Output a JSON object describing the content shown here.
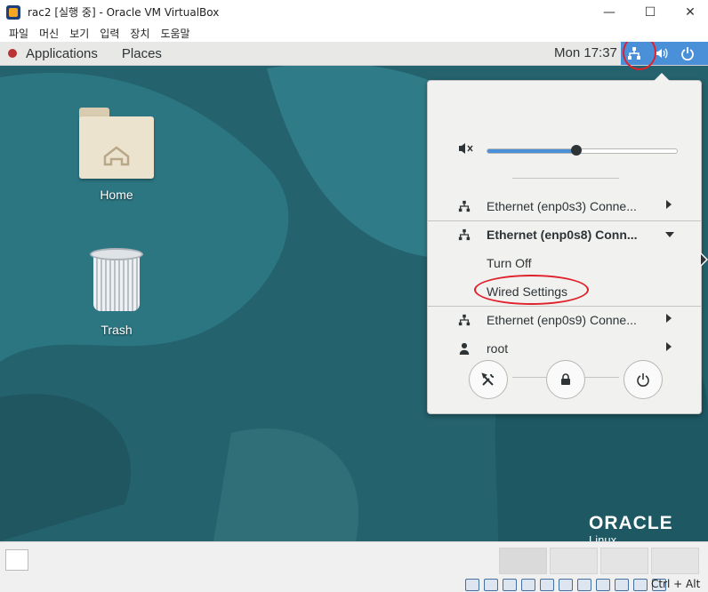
{
  "window": {
    "title": "rac2 [실행 중] - Oracle VM VirtualBox",
    "minimize": "—",
    "maximize": "☐",
    "close": "✕"
  },
  "menubar": [
    "파일",
    "머신",
    "보기",
    "입력",
    "장치",
    "도움말"
  ],
  "topbar": {
    "applications": "Applications",
    "places": "Places",
    "clock": "Mon 17:37"
  },
  "desktop": {
    "home_label": "Home",
    "trash_label": "Trash",
    "logo": "ORACLE",
    "logo_sub": "Linux"
  },
  "system_menu": {
    "volume_level": 0.47,
    "connections": [
      {
        "label": "Ethernet (enp0s3) Conne...",
        "expanded": false
      },
      {
        "label": "Ethernet (enp0s8) Conn...",
        "expanded": true
      },
      {
        "label": "Ethernet (enp0s9) Conne...",
        "expanded": false
      }
    ],
    "submenu": {
      "turn_off": "Turn Off",
      "wired_settings": "Wired Settings"
    },
    "user": "root",
    "icons": [
      "settings-icon",
      "lock-icon",
      "power-icon"
    ]
  },
  "statusbar": {
    "host_key": "Ctrl + Alt"
  },
  "colors": {
    "accent": "#4a90d9",
    "annotation": "#e0212b",
    "desktop": "#24626d"
  }
}
